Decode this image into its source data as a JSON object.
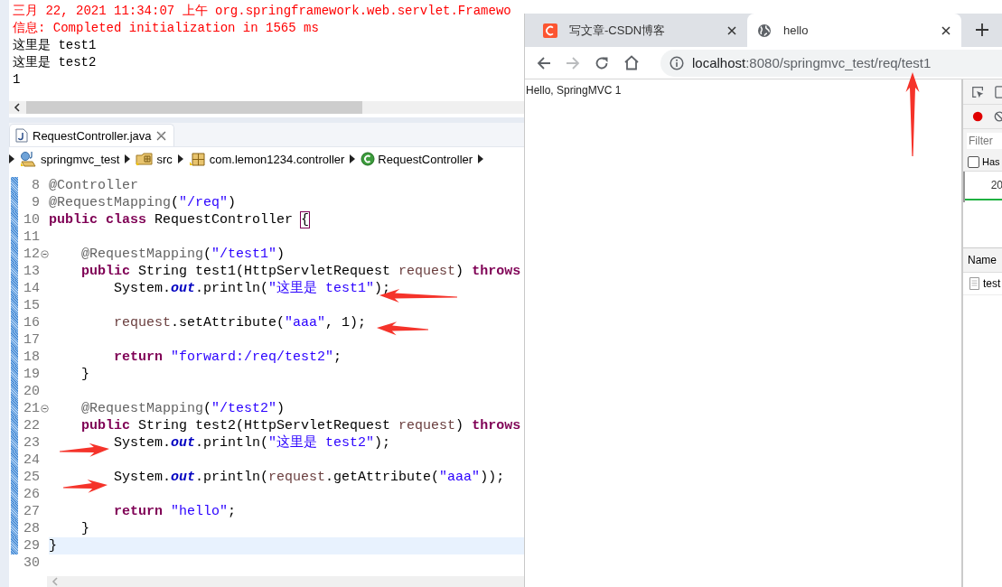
{
  "console": {
    "lines": [
      {
        "kind": "stderr",
        "text": "三月 22, 2021 11:34:07 上午 org.springframework.web.servlet.Framewo"
      },
      {
        "kind": "stderr",
        "text": "信息: Completed initialization in 1565 ms"
      },
      {
        "kind": "stdout",
        "text": "这里是 test1"
      },
      {
        "kind": "stdout",
        "text": "这里是 test2"
      },
      {
        "kind": "stdout",
        "text": "1"
      }
    ]
  },
  "editor": {
    "tab": {
      "title": "RequestController.java",
      "selected": true
    },
    "breadcrumb": [
      {
        "kind": "project",
        "label": "springmvc_test"
      },
      {
        "kind": "folder",
        "label": "src"
      },
      {
        "kind": "package",
        "label": "com.lemon1234.controller"
      },
      {
        "kind": "class",
        "label": "RequestController"
      }
    ],
    "lines": [
      {
        "number": "8",
        "changed": true,
        "current": false,
        "foldable": false,
        "tokens": [
          {
            "kind": "annotation",
            "text": "@Controller"
          }
        ]
      },
      {
        "number": "9",
        "changed": true,
        "current": false,
        "foldable": false,
        "tokens": [
          {
            "kind": "annotation",
            "text": "@RequestMapping"
          },
          {
            "kind": "plain",
            "text": "("
          },
          {
            "kind": "string",
            "text": "\"/req\""
          },
          {
            "kind": "plain",
            "text": ")"
          }
        ]
      },
      {
        "number": "10",
        "changed": true,
        "current": false,
        "foldable": false,
        "tokens": [
          {
            "kind": "keyword",
            "text": "public class"
          },
          {
            "kind": "plain",
            "text": " RequestController "
          },
          {
            "kind": "match",
            "text": "{"
          }
        ]
      },
      {
        "number": "11",
        "changed": true,
        "current": false,
        "foldable": false
      },
      {
        "number": "12",
        "changed": true,
        "current": false,
        "foldable": true,
        "tokens": [
          {
            "kind": "annotation",
            "text": "    @RequestMapping"
          },
          {
            "kind": "plain",
            "text": "("
          },
          {
            "kind": "string",
            "text": "\"/test1\""
          },
          {
            "kind": "plain",
            "text": ")"
          }
        ]
      },
      {
        "number": "13",
        "changed": true,
        "current": false,
        "foldable": false,
        "tokens": [
          {
            "kind": "keyword",
            "text": "    public"
          },
          {
            "kind": "plain",
            "text": " String test1(HttpServletRequest "
          },
          {
            "kind": "param",
            "text": "request"
          },
          {
            "kind": "plain",
            "text": ") "
          },
          {
            "kind": "keyword",
            "text": "throws"
          }
        ]
      },
      {
        "number": "14",
        "changed": true,
        "current": false,
        "foldable": false,
        "tokens": [
          {
            "kind": "plain",
            "text": "        System."
          },
          {
            "kind": "field",
            "text": "out"
          },
          {
            "kind": "plain",
            "text": ".println("
          },
          {
            "kind": "string",
            "text": "\"这里是 test1\""
          },
          {
            "kind": "plain",
            "text": ");"
          }
        ]
      },
      {
        "number": "15",
        "changed": true,
        "current": false,
        "foldable": false
      },
      {
        "number": "16",
        "changed": true,
        "current": false,
        "foldable": false,
        "tokens": [
          {
            "kind": "param",
            "text": "        request"
          },
          {
            "kind": "plain",
            "text": ".setAttribute("
          },
          {
            "kind": "string",
            "text": "\"aaa\""
          },
          {
            "kind": "plain",
            "text": ", 1);"
          }
        ]
      },
      {
        "number": "17",
        "changed": true,
        "current": false,
        "foldable": false
      },
      {
        "number": "18",
        "changed": true,
        "current": false,
        "foldable": false,
        "tokens": [
          {
            "kind": "keyword",
            "text": "        return"
          },
          {
            "kind": "string",
            "text": " \"forward:/req/test2\""
          },
          {
            "kind": "plain",
            "text": ";"
          }
        ]
      },
      {
        "number": "19",
        "changed": true,
        "current": false,
        "foldable": false,
        "tokens": [
          {
            "kind": "plain",
            "text": "    }"
          }
        ]
      },
      {
        "number": "20",
        "changed": true,
        "current": false,
        "foldable": false
      },
      {
        "number": "21",
        "changed": true,
        "current": false,
        "foldable": true,
        "tokens": [
          {
            "kind": "annotation",
            "text": "    @RequestMapping"
          },
          {
            "kind": "plain",
            "text": "("
          },
          {
            "kind": "string",
            "text": "\"/test2\""
          },
          {
            "kind": "plain",
            "text": ")"
          }
        ]
      },
      {
        "number": "22",
        "changed": true,
        "current": false,
        "foldable": false,
        "tokens": [
          {
            "kind": "keyword",
            "text": "    public"
          },
          {
            "kind": "plain",
            "text": " String test2(HttpServletRequest "
          },
          {
            "kind": "param",
            "text": "request"
          },
          {
            "kind": "plain",
            "text": ") "
          },
          {
            "kind": "keyword",
            "text": "throws"
          }
        ]
      },
      {
        "number": "23",
        "changed": true,
        "current": false,
        "foldable": false,
        "tokens": [
          {
            "kind": "plain",
            "text": "        System."
          },
          {
            "kind": "field",
            "text": "out"
          },
          {
            "kind": "plain",
            "text": ".println("
          },
          {
            "kind": "string",
            "text": "\"这里是 test2\""
          },
          {
            "kind": "plain",
            "text": ");"
          }
        ]
      },
      {
        "number": "24",
        "changed": true,
        "current": false,
        "foldable": false
      },
      {
        "number": "25",
        "changed": true,
        "current": false,
        "foldable": false,
        "tokens": [
          {
            "kind": "plain",
            "text": "        System."
          },
          {
            "kind": "field",
            "text": "out"
          },
          {
            "kind": "plain",
            "text": ".println("
          },
          {
            "kind": "param",
            "text": "request"
          },
          {
            "kind": "plain",
            "text": ".getAttribute("
          },
          {
            "kind": "string",
            "text": "\"aaa\""
          },
          {
            "kind": "plain",
            "text": "));"
          }
        ]
      },
      {
        "number": "26",
        "changed": true,
        "current": false,
        "foldable": false
      },
      {
        "number": "27",
        "changed": true,
        "current": false,
        "foldable": false,
        "tokens": [
          {
            "kind": "keyword",
            "text": "        return"
          },
          {
            "kind": "string",
            "text": " \"hello\""
          },
          {
            "kind": "plain",
            "text": ";"
          }
        ]
      },
      {
        "number": "28",
        "changed": true,
        "current": false,
        "foldable": false,
        "tokens": [
          {
            "kind": "plain",
            "text": "    }"
          }
        ]
      },
      {
        "number": "29",
        "changed": true,
        "current": true,
        "foldable": false,
        "tokens": [
          {
            "kind": "plain",
            "text": "}"
          }
        ]
      },
      {
        "number": "30",
        "changed": false,
        "current": false,
        "foldable": false
      }
    ]
  },
  "browser": {
    "tabs": [
      {
        "kind": "csdn",
        "title": "写文章-CSDN博客",
        "selected": false
      },
      {
        "kind": "globe",
        "title": "hello",
        "selected": true
      }
    ],
    "forward_disabled": true,
    "address": {
      "host": "localhost",
      "rest": ":8080/springmvc_test/req/test1"
    },
    "page_text": "Hello, SpringMVC 1",
    "devtools": {
      "recording": true,
      "filter_placeholder": "Filter",
      "checkbox_label": "Has",
      "checkbox_checked": false,
      "timeline_label": "20",
      "name_header": "Name",
      "requests": [
        "test"
      ]
    }
  }
}
